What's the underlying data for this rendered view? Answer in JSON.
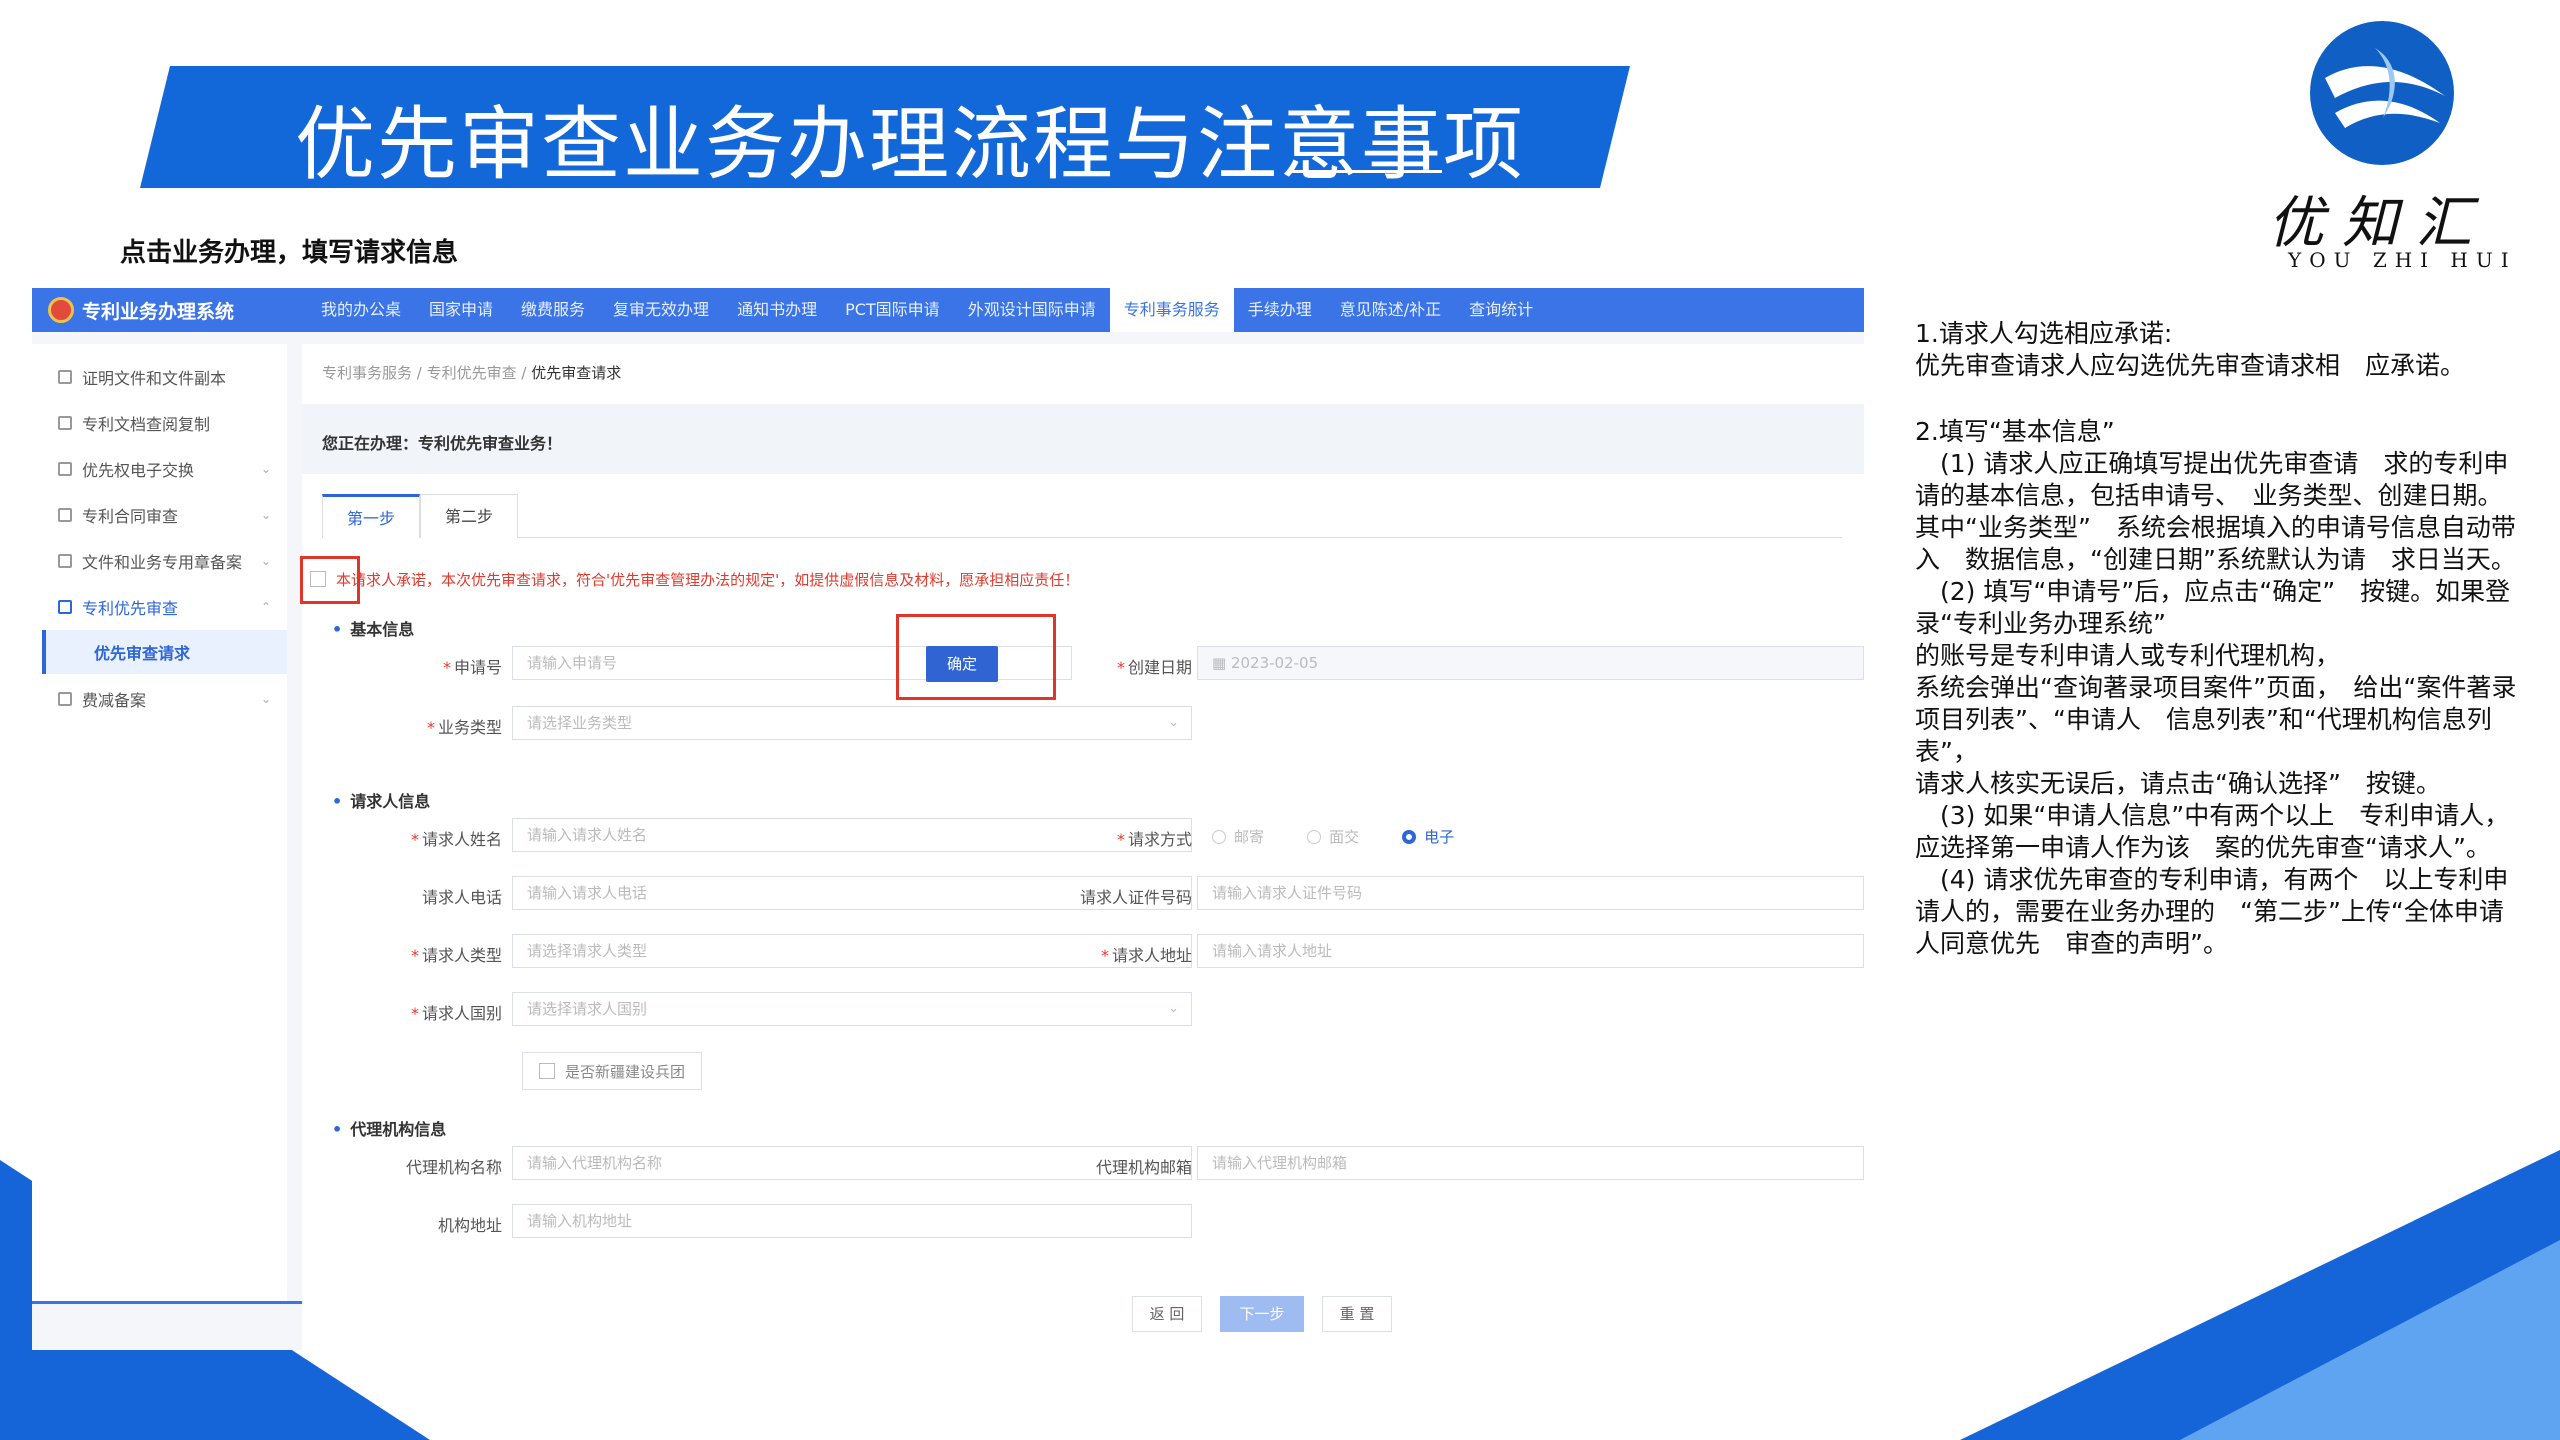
{
  "slide": {
    "title": "优先审查业务办理流程与注意事项",
    "subtitle": "点击业务办理，填写请求信息",
    "logo_cn": "优知汇",
    "logo_en": "YOU ZHI HUI"
  },
  "app": {
    "brand": "专利业务办理系统",
    "nav": [
      "我的办公桌",
      "国家申请",
      "缴费服务",
      "复审无效办理",
      "通知书办理",
      "PCT国际申请",
      "外观设计国际申请",
      "专利事务服务",
      "手续办理",
      "意见陈述/补正",
      "查询统计"
    ],
    "active_nav": "专利事务服务",
    "sidebar": {
      "items": [
        {
          "label": "证明文件和文件副本",
          "expandable": false
        },
        {
          "label": "专利文档查阅复制",
          "expandable": false
        },
        {
          "label": "优先权电子交换",
          "expandable": true
        },
        {
          "label": "专利合同审查",
          "expandable": true
        },
        {
          "label": "文件和业务专用章备案",
          "expandable": true
        },
        {
          "label": "专利优先审查",
          "expandable": true
        },
        {
          "label": "费减备案",
          "expandable": true
        }
      ],
      "sub_item": "优先审查请求"
    },
    "breadcrumb": {
      "part1": "专利事务服务",
      "part2": "专利优先审查",
      "current": "优先审查请求"
    },
    "doing_text": "您正在办理：专利优先审查业务！",
    "tabs": [
      "第一步",
      "第二步"
    ],
    "promise_text": "本请求人承诺，本次优先审查请求，符合'优先审查管理办法的规定'，如提供虚假信息及材料，愿承担相应责任！",
    "sections": {
      "basic": "基本信息",
      "requester": "请求人信息",
      "agency": "代理机构信息"
    },
    "fields": {
      "application_no": {
        "label": "申请号",
        "placeholder": "请输入申请号"
      },
      "confirm_button": "确定",
      "create_date": {
        "label": "创建日期",
        "value": "2023-02-05"
      },
      "business_type": {
        "label": "业务类型",
        "placeholder": "请选择业务类型"
      },
      "requester_name": {
        "label": "请求人姓名",
        "placeholder": "请输入请求人姓名"
      },
      "request_method": {
        "label": "请求方式",
        "options": [
          "邮寄",
          "面交",
          "电子"
        ],
        "selected": "电子"
      },
      "requester_phone": {
        "label": "请求人电话",
        "placeholder": "请输入请求人电话"
      },
      "requester_id": {
        "label": "请求人证件号码",
        "placeholder": "请输入请求人证件号码"
      },
      "requester_type": {
        "label": "请求人类型",
        "placeholder": "请选择请求人类型"
      },
      "requester_address": {
        "label": "请求人地址",
        "placeholder": "请输入请求人地址"
      },
      "requester_country": {
        "label": "请求人国别",
        "placeholder": "请选择请求人国别"
      },
      "xinjiang_corps": "是否新疆建设兵团",
      "agency_name": {
        "label": "代理机构名称",
        "placeholder": "请输入代理机构名称"
      },
      "agency_email": {
        "label": "代理机构邮箱",
        "placeholder": "请输入代理机构邮箱"
      },
      "agency_address": {
        "label": "机构地址",
        "placeholder": "请输入机构地址"
      }
    },
    "buttons": {
      "back": "返 回",
      "next": "下一步",
      "reset": "重 置"
    }
  },
  "notes": {
    "p1_title": "1.请求人勾选相应承诺:",
    "p1_body": "优先审查请求人应勾选优先审查请求相　应承诺。",
    "p2_title": "2.填写“基本信息”",
    "p2_1": "　(1) 请求人应正确填写提出优先审查请　求的专利申请的基本信息，包括申请号、　业务类型、创建日期。其中“业务类型”　系统会根据填入的申请号信息自动带入　数据信息，“创建日期”系统默认为请　求日当天。",
    "p2_2": "　(2) 填写“申请号”后，应点击“确定”　按键。如果登录“专利业务办理系统”",
    "p2_3": "的账号是专利申请人或专利代理机构，",
    "p2_4": "系统会弹出“查询著录项目案件”页面，　给出“案件著录项目列表”、“申请人　信息列表”和“代理机构信息列表”，",
    "p2_5": "请求人核实无误后，请点击“确认选择”　按键。",
    "p2_6": "　(3) 如果“申请人信息”中有两个以上　专利申请人，应选择第一申请人作为该　案的优先审查“请求人”。",
    "p2_7": "　(4) 请求优先审查的专利申请，有两个　以上专利申请人的，需要在业务办理的　“第二步”上传“全体申请人同意优先　审查的声明”。"
  },
  "colors": {
    "brand_blue": "#1368d9",
    "nav_blue": "#3a74e6",
    "highlight_red": "#e0362a"
  }
}
